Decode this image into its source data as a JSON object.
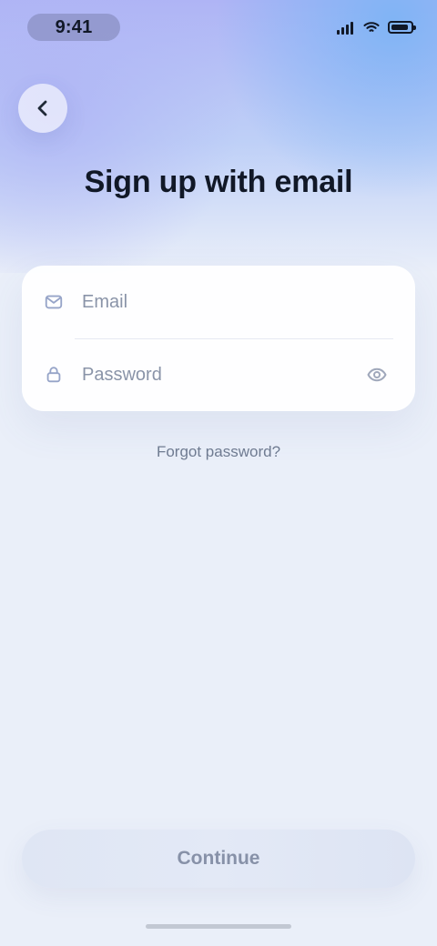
{
  "status_bar": {
    "time": "9:41",
    "signal_icon": "cellular-signal-icon",
    "wifi_icon": "wifi-icon",
    "battery_icon": "battery-icon"
  },
  "navigation": {
    "back_icon": "chevron-left-icon"
  },
  "page": {
    "title": "Sign up with email"
  },
  "form": {
    "email": {
      "icon": "mail-icon",
      "value": "",
      "placeholder": "Email"
    },
    "password": {
      "icon": "lock-icon",
      "value": "",
      "placeholder": "Password",
      "toggle_icon": "eye-icon"
    }
  },
  "links": {
    "forgot_password": "Forgot password?"
  },
  "actions": {
    "primary": "Continue"
  },
  "colors": {
    "title_text": "#111827",
    "secondary_text": "#6f7b91",
    "field_icon": "#96a4c8",
    "background": "#eaeff9",
    "button_background": "#dfe6f4",
    "button_text": "#8791a8"
  }
}
